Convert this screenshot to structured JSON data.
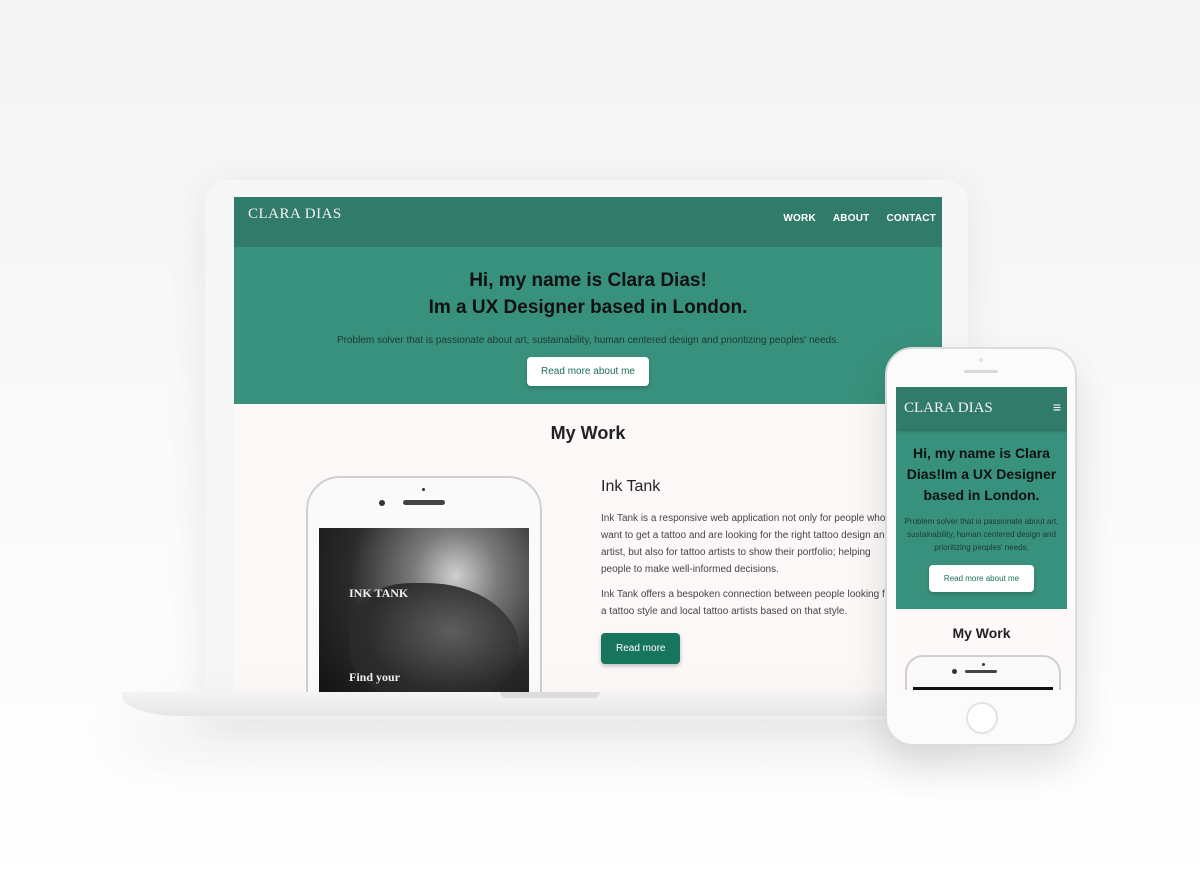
{
  "brand": "CLARA DIAS",
  "desktop": {
    "nav": {
      "work": "WORK",
      "about": "ABOUT",
      "contact": "CONTACT"
    },
    "hero": {
      "title_line1": "Hi, my name is Clara Dias!",
      "title_line2": "Im a UX Designer based in London.",
      "subtitle": "Problem solver that is passionate about art, sustainability, human centered design and prioritizing peoples' needs.",
      "button": "Read more about me"
    },
    "work": {
      "title": "My Work",
      "project": {
        "name": "Ink Tank",
        "desc1": "Ink Tank is a responsive web application not only for people who want to get a tattoo and are looking for the right tattoo design and artist, but also for tattoo artists to show their portfolio; helping people to make well-informed decisions.",
        "desc2": "Ink Tank offers a bespoken connection between people looking for a tattoo style and local tattoo artists based on that style.",
        "button": "Read more",
        "mock_title": "INK TANK",
        "mock_tagline": "Find your"
      }
    }
  },
  "mobile": {
    "menu_icon": "≡",
    "hero": {
      "title": "Hi, my name is Clara Dias!Im a UX Designer based in London.",
      "subtitle": "Problem solver that is passionate about art, sustainability, human centered design and prioritizing peoples' needs.",
      "button": "Read more about me"
    },
    "work_title": "My Work"
  },
  "colors": {
    "nav": "#317b6b",
    "hero": "#38917c",
    "primary_button": "#17755d"
  }
}
